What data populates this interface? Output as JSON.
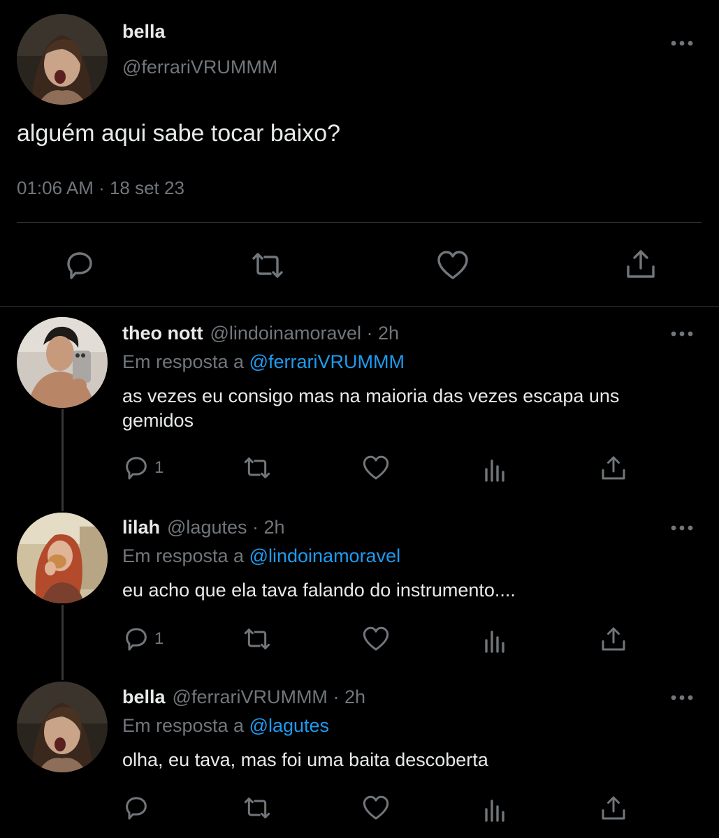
{
  "colors": {
    "background": "#000000",
    "text": "#e7e9ea",
    "secondary": "#71767b",
    "accent": "#1d9bf0",
    "divider": "#2f3336"
  },
  "main_tweet": {
    "name": "bella",
    "handle": "@ferrariVRUMMM",
    "text": "alguém aqui sabe tocar baixo?",
    "timestamp": "01:06 AM · 18 set 23",
    "more_icon": "more-horizontal-icon",
    "actions": [
      "reply-icon",
      "retweet-icon",
      "like-icon",
      "share-icon"
    ]
  },
  "replies": [
    {
      "name": "theo nott",
      "handle": "@lindoinamoravel",
      "dot": " · ",
      "time": "2h",
      "reply_prefix": "Em resposta a ",
      "reply_to": "@ferrariVRUMMM",
      "text": "as vezes eu consigo mas na maioria das vezes escapa uns gemidos",
      "reply_count": "1"
    },
    {
      "name": "lilah",
      "handle": "@lagutes",
      "dot": " · ",
      "time": "2h",
      "reply_prefix": "Em resposta a ",
      "reply_to": "@lindoinamoravel",
      "text": "eu acho que ela tava falando do instrumento....",
      "reply_count": "1"
    },
    {
      "name": "bella",
      "handle": "@ferrariVRUMMM",
      "dot": " · ",
      "time": "2h",
      "reply_prefix": "Em resposta a ",
      "reply_to": "@lagutes",
      "text": "olha, eu tava, mas foi uma baita descoberta",
      "reply_count": ""
    }
  ]
}
